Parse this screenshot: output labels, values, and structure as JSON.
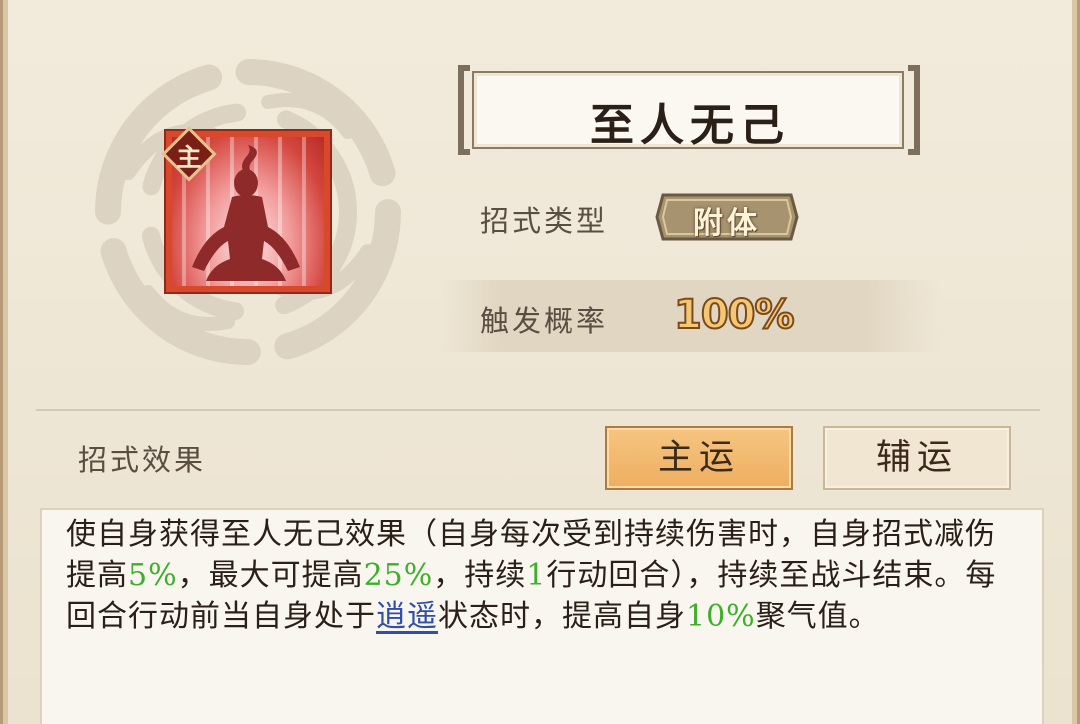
{
  "skill": {
    "name": "至人无己",
    "badge": "主",
    "type_label": "招式类型",
    "type_value": "附体",
    "rate_label": "触发概率",
    "rate_value": "100%"
  },
  "effect": {
    "label": "招式效果",
    "tabs": [
      {
        "label": "主运",
        "selected": true
      },
      {
        "label": "辅运",
        "selected": false
      }
    ],
    "description_parts": [
      {
        "text": "使自身获得至人无己效果（自身每次受到持续伤害时，自身招式减伤提高",
        "style": "normal"
      },
      {
        "text": "5%",
        "style": "green"
      },
      {
        "text": "，最大可提高",
        "style": "normal"
      },
      {
        "text": "25%",
        "style": "green"
      },
      {
        "text": "，持续",
        "style": "normal"
      },
      {
        "text": "1",
        "style": "green"
      },
      {
        "text": "行动回合），持续至战斗结束。每回合行动前当自身处于",
        "style": "normal"
      },
      {
        "text": "逍遥",
        "style": "link"
      },
      {
        "text": "状态时，提高自身",
        "style": "normal"
      },
      {
        "text": "10%",
        "style": "green"
      },
      {
        "text": "聚气值。",
        "style": "normal"
      }
    ]
  },
  "colors": {
    "highlight_green": "#3fae2c",
    "link_blue": "#2f4fa8",
    "selected_tab": "#eeae60",
    "icon_frame": "#d8492c"
  }
}
